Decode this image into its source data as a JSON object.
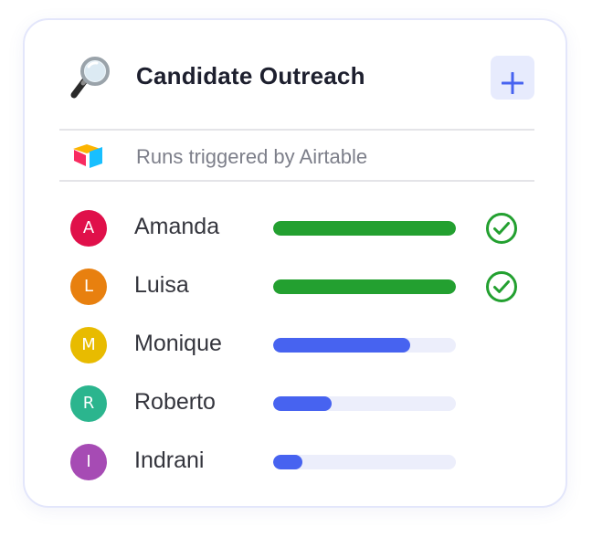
{
  "header": {
    "title": "Candidate Outreach",
    "icon": "magnifying-glass-icon",
    "add_button_icon": "plus-icon"
  },
  "source": {
    "text": "Runs triggered by Airtable",
    "logo": "airtable-logo"
  },
  "colors": {
    "complete": "#23a030",
    "in_progress": "#4763f0",
    "track": "#eceefb",
    "accent_button_bg": "#e7ebfd"
  },
  "candidates": [
    {
      "initial": "A",
      "name": "Amanda",
      "avatar_color": "#e0104a",
      "progress": 1.0,
      "status": "complete"
    },
    {
      "initial": "L",
      "name": "Luisa",
      "avatar_color": "#e8800f",
      "progress": 1.0,
      "status": "complete"
    },
    {
      "initial": "M",
      "name": "Monique",
      "avatar_color": "#e8bb00",
      "progress": 0.75,
      "status": "in-progress"
    },
    {
      "initial": "R",
      "name": "Roberto",
      "avatar_color": "#2bb58e",
      "progress": 0.32,
      "status": "in-progress"
    },
    {
      "initial": "I",
      "name": "Indrani",
      "avatar_color": "#a64bb4",
      "progress": 0.16,
      "status": "in-progress"
    }
  ]
}
